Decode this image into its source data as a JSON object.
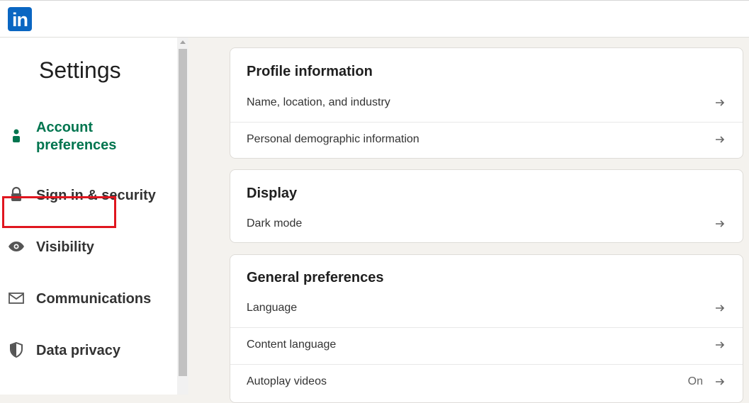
{
  "header": {
    "logo_text": "in"
  },
  "sidebar": {
    "title": "Settings",
    "items": [
      {
        "label_line1": "Account",
        "label_line2": "preferences",
        "icon": "person-icon",
        "active": true
      },
      {
        "label": "Sign in & security",
        "icon": "lock-icon"
      },
      {
        "label": "Visibility",
        "icon": "eye-icon",
        "highlighted": true
      },
      {
        "label": "Communications",
        "icon": "envelope-icon"
      },
      {
        "label": "Data privacy",
        "icon": "shield-icon"
      }
    ]
  },
  "cards": {
    "profile": {
      "title": "Profile information",
      "rows": [
        {
          "label": "Name, location, and industry"
        },
        {
          "label": "Personal demographic information"
        }
      ]
    },
    "display": {
      "title": "Display",
      "rows": [
        {
          "label": "Dark mode"
        }
      ]
    },
    "general": {
      "title": "General preferences",
      "rows": [
        {
          "label": "Language"
        },
        {
          "label": "Content language"
        },
        {
          "label": "Autoplay videos",
          "value": "On"
        }
      ]
    }
  },
  "colors": {
    "brand": "#0a66c2",
    "active_nav": "#01754f",
    "highlight_box": "#e0161f"
  }
}
